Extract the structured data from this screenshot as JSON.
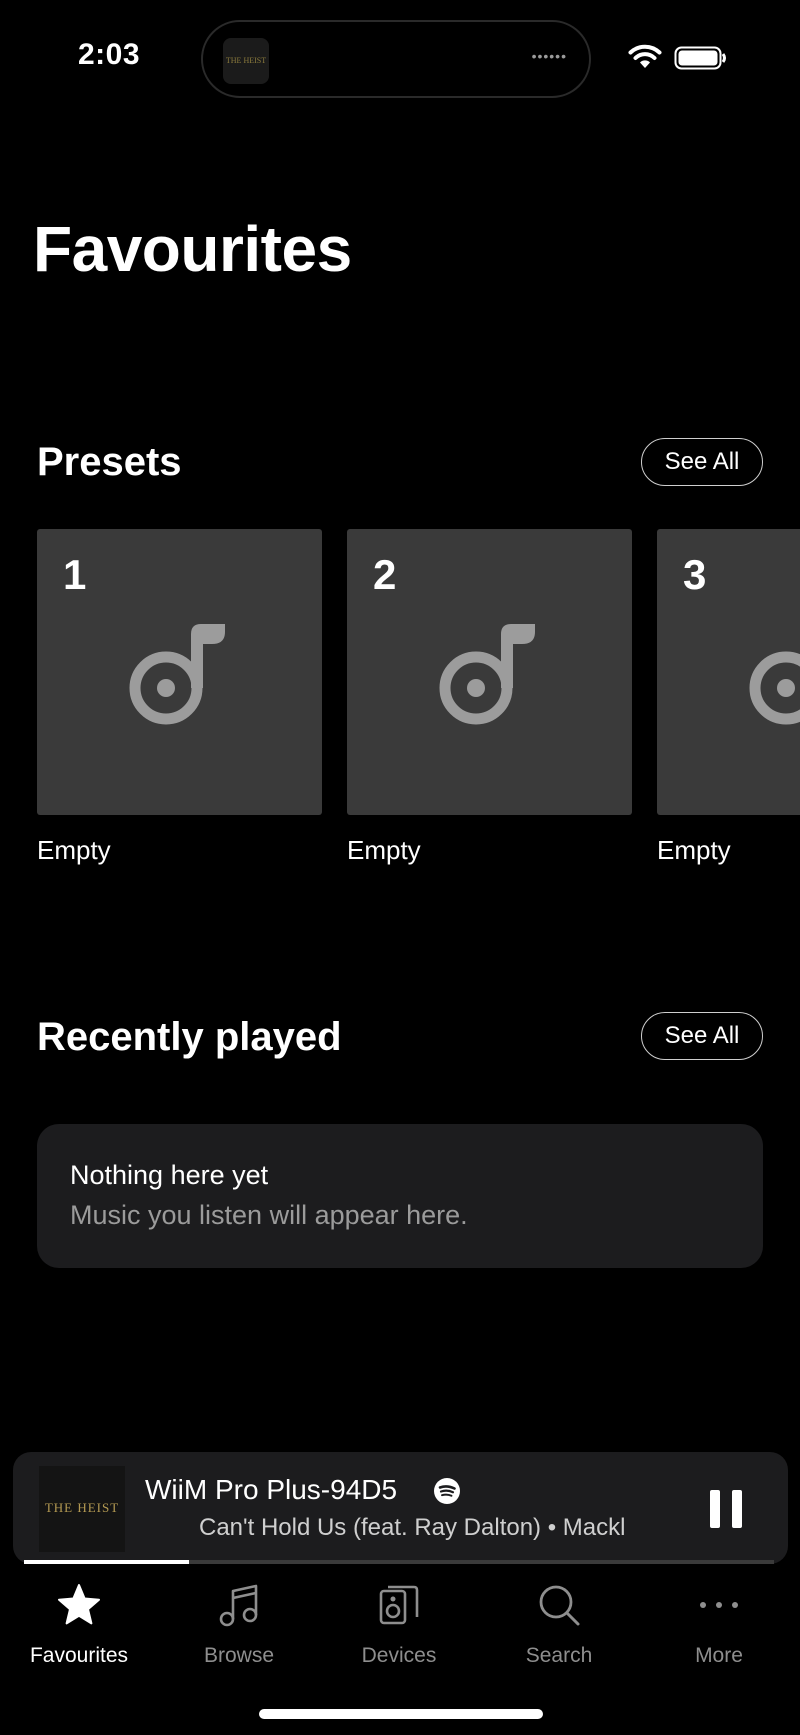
{
  "status_bar": {
    "time": "2:03",
    "island_art_text": "THE HEIST",
    "island_dots": "••••••"
  },
  "page": {
    "title": "Favourites"
  },
  "presets": {
    "title": "Presets",
    "see_all_label": "See All",
    "items": [
      {
        "number": "1",
        "label": "Empty",
        "icon": "music-note-icon"
      },
      {
        "number": "2",
        "label": "Empty",
        "icon": "music-note-icon"
      },
      {
        "number": "3",
        "label": "Empty",
        "icon": "music-note-icon"
      }
    ]
  },
  "recently_played": {
    "title": "Recently played",
    "see_all_label": "See All",
    "empty_title": "Nothing here yet",
    "empty_subtitle": "Music you listen will appear here."
  },
  "now_playing": {
    "device": "WiiM Pro Plus-94D5",
    "track": "Can't Hold Us (feat. Ray Dalton) • Mackl",
    "album_art_text": "THE HEIST",
    "source_icon": "spotify-icon",
    "progress": 0.22
  },
  "tabs": [
    {
      "label": "Favourites",
      "icon": "star-icon",
      "active": true
    },
    {
      "label": "Browse",
      "icon": "music-notes-icon",
      "active": false
    },
    {
      "label": "Devices",
      "icon": "speaker-icon",
      "active": false
    },
    {
      "label": "Search",
      "icon": "search-icon",
      "active": false
    },
    {
      "label": "More",
      "icon": "more-icon",
      "active": false
    }
  ],
  "colors": {
    "background": "#000000",
    "tile": "#3a3a3a",
    "card": "#1c1c1e",
    "muted_text": "#8e8e8e",
    "icon_gray": "#9c9c9c"
  }
}
